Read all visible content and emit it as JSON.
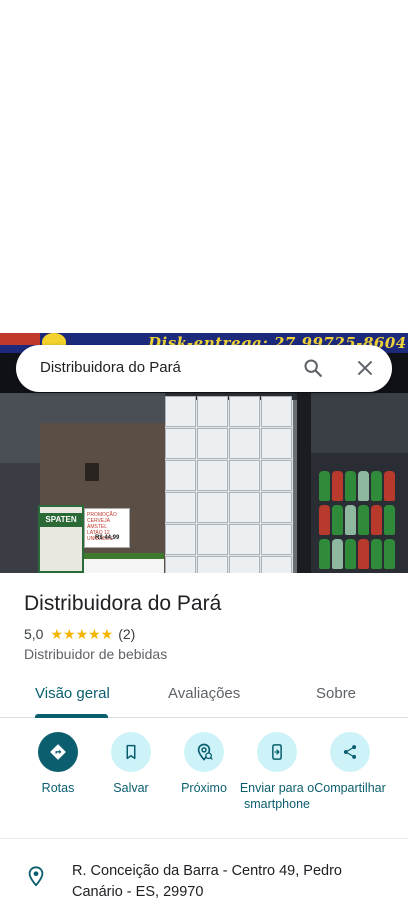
{
  "search": {
    "query": "Distribuidora do Pará"
  },
  "photo": {
    "banner_text": "Disk-entrega: 27 99725-8604"
  },
  "place": {
    "name": "Distribuidora do Pará",
    "rating": "5,0",
    "stars": "★★★★★",
    "review_count": "(2)",
    "category": "Distribuidor de bebidas"
  },
  "tabs": [
    {
      "label": "Visão geral",
      "active": true
    },
    {
      "label": "Avaliações",
      "active": false
    },
    {
      "label": "Sobre",
      "active": false
    }
  ],
  "actions": [
    {
      "label": "Rotas",
      "icon": "directions-icon"
    },
    {
      "label": "Salvar",
      "icon": "bookmark-icon"
    },
    {
      "label": "Próximo",
      "icon": "nearby-icon"
    },
    {
      "label": "Enviar para o smartphone",
      "icon": "send-to-phone-icon"
    },
    {
      "label": "Compartilhar",
      "icon": "share-icon"
    }
  ],
  "address": {
    "text": "R. Conceição da Barra - Centro 49, Pedro Canário - ES, 29970"
  },
  "colors": {
    "accent": "#0b5e6e",
    "accent_light": "#cdf3f9",
    "star": "#f4b400"
  }
}
